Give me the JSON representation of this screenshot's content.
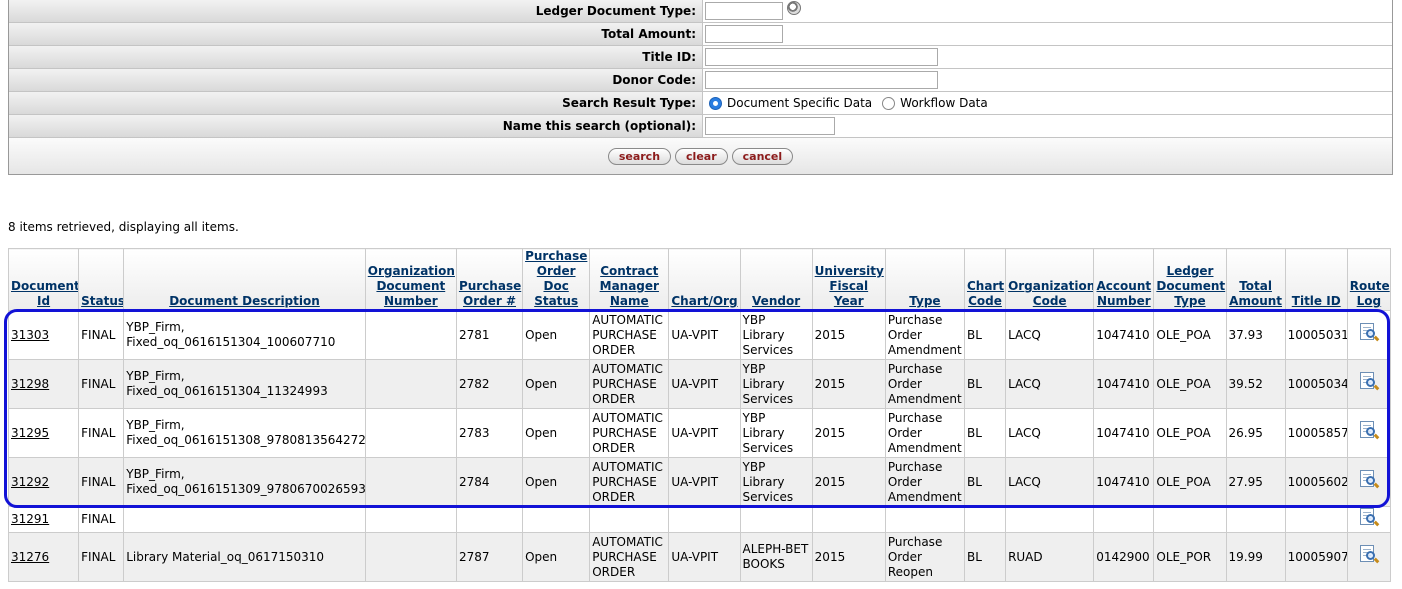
{
  "criteria": {
    "ledger_document_type_label": "Ledger Document Type:",
    "ledger_document_type_value": "",
    "total_amount_label": "Total Amount:",
    "total_amount_value": "",
    "title_id_label": "Title ID:",
    "title_id_value": "",
    "donor_code_label": "Donor Code:",
    "donor_code_value": "",
    "search_result_type_label": "Search Result Type:",
    "result_type_options": [
      "Document Specific Data",
      "Workflow Data"
    ],
    "result_type_selected": "Document Specific Data",
    "name_search_label": "Name this search (optional):",
    "name_search_value": "",
    "buttons": {
      "search": "search",
      "clear": "clear",
      "cancel": "cancel"
    }
  },
  "results_summary": "8 items retrieved, displaying all items.",
  "table": {
    "headers": [
      "Document Id",
      "Status",
      "Document Description",
      "Organization Document Number",
      "Purchase Order #",
      "Purchase Order Doc Status",
      "Contract Manager Name",
      "Chart/Org",
      "Vendor",
      "University Fiscal Year",
      "Type",
      "Chart Code",
      "Organization Code",
      "Account Number",
      "Ledger Document Type",
      "Total Amount",
      "Title ID",
      "Route Log"
    ],
    "rows": [
      [
        "31303",
        "FINAL",
        "YBP_Firm, Fixed_oq_0616151304_100607710",
        "",
        "2781",
        "Open",
        "AUTOMATIC PURCHASE ORDER",
        "UA-VPIT",
        "YBP Library Services",
        "2015",
        "Purchase Order Amendment",
        "BL",
        "LACQ",
        "1047410",
        "OLE_POA",
        "37.93",
        "10005031"
      ],
      [
        "31298",
        "FINAL",
        "YBP_Firm, Fixed_oq_0616151304_11324993",
        "",
        "2782",
        "Open",
        "AUTOMATIC PURCHASE ORDER",
        "UA-VPIT",
        "YBP Library Services",
        "2015",
        "Purchase Order Amendment",
        "BL",
        "LACQ",
        "1047410",
        "OLE_POA",
        "39.52",
        "10005034"
      ],
      [
        "31295",
        "FINAL",
        "YBP_Firm, Fixed_oq_0616151308_9780813564272",
        "",
        "2783",
        "Open",
        "AUTOMATIC PURCHASE ORDER",
        "UA-VPIT",
        "YBP Library Services",
        "2015",
        "Purchase Order Amendment",
        "BL",
        "LACQ",
        "1047410",
        "OLE_POA",
        "26.95",
        "10005857"
      ],
      [
        "31292",
        "FINAL",
        "YBP_Firm, Fixed_oq_0616151309_9780670026593",
        "",
        "2784",
        "Open",
        "AUTOMATIC PURCHASE ORDER",
        "UA-VPIT",
        "YBP Library Services",
        "2015",
        "Purchase Order Amendment",
        "BL",
        "LACQ",
        "1047410",
        "OLE_POA",
        "27.95",
        "10005602"
      ],
      [
        "31291",
        "FINAL",
        "",
        "",
        "",
        "",
        "",
        "",
        "",
        "",
        "",
        "",
        "",
        "",
        "",
        "",
        ""
      ],
      [
        "31276",
        "FINAL",
        "Library Material_oq_0617150310",
        "",
        "2787",
        "Open",
        "AUTOMATIC PURCHASE ORDER",
        "UA-VPIT",
        "ALEPH-BET BOOKS",
        "2015",
        "Purchase Order Reopen",
        "BL",
        "RUAD",
        "0142900",
        "OLE_POR",
        "19.99",
        "10005907"
      ]
    ]
  },
  "highlight_color": "#1212d6"
}
